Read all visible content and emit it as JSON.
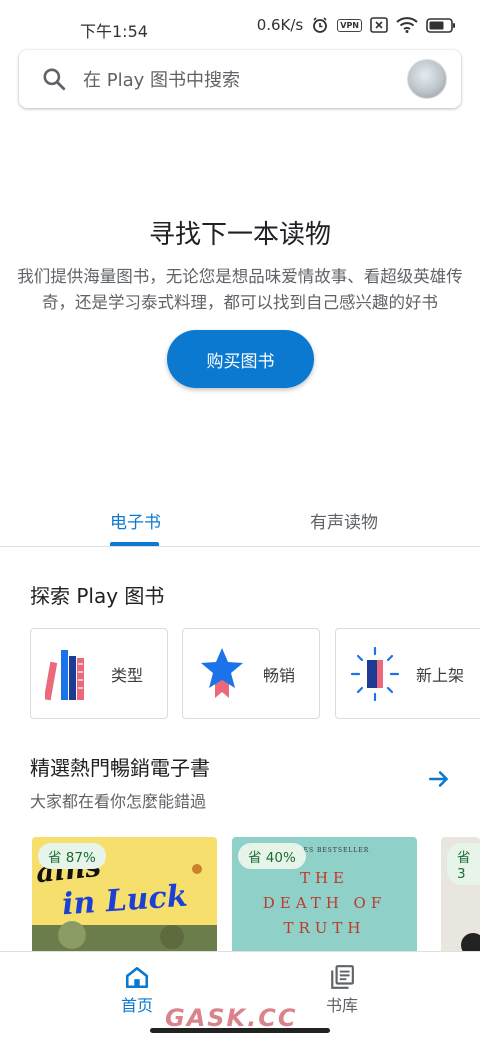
{
  "status_bar": {
    "time": "下午1:54",
    "speed": "0.6K/s",
    "vpn": "VPN"
  },
  "search": {
    "placeholder": "在 Play 图书中搜索"
  },
  "promo": {
    "title": "寻找下一本读物",
    "description_line1": "我们提供海量图书，无论您是想品味爱情故事、看超级英雄传",
    "description_line2": "奇，还是学习泰式料理，都可以找到自己感兴趣的好书",
    "button_label": "购买图书"
  },
  "tabs": [
    {
      "label": "电子书",
      "selected": true
    },
    {
      "label": "有声读物",
      "selected": false
    }
  ],
  "explore": {
    "title": "探索 Play 图书",
    "categories": [
      {
        "label": "类型",
        "icon": "books-icon"
      },
      {
        "label": "畅销",
        "icon": "star-ribbon-icon"
      },
      {
        "label": "新上架",
        "icon": "new-book-icon"
      }
    ]
  },
  "bestsellers": {
    "title": "精選熱門暢銷電子書",
    "subtitle": "大家都在看你怎麼能錯過",
    "books": [
      {
        "discount": "省 87%",
        "cover_text": "in Luck"
      },
      {
        "discount": "省 40%",
        "cover_lines": [
          "K TIMES BESTSELLER",
          "THE",
          "DEATH OF",
          "TRUTH"
        ]
      },
      {
        "discount": "省 3"
      }
    ]
  },
  "bottom_nav": [
    {
      "label": "首页",
      "selected": true
    },
    {
      "label": "书库",
      "selected": false
    }
  ],
  "watermark": "GASK.CC",
  "colors": {
    "accent": "#0b79d0",
    "discount_bg": "#e6f4ea",
    "discount_text": "#1e6a35"
  }
}
